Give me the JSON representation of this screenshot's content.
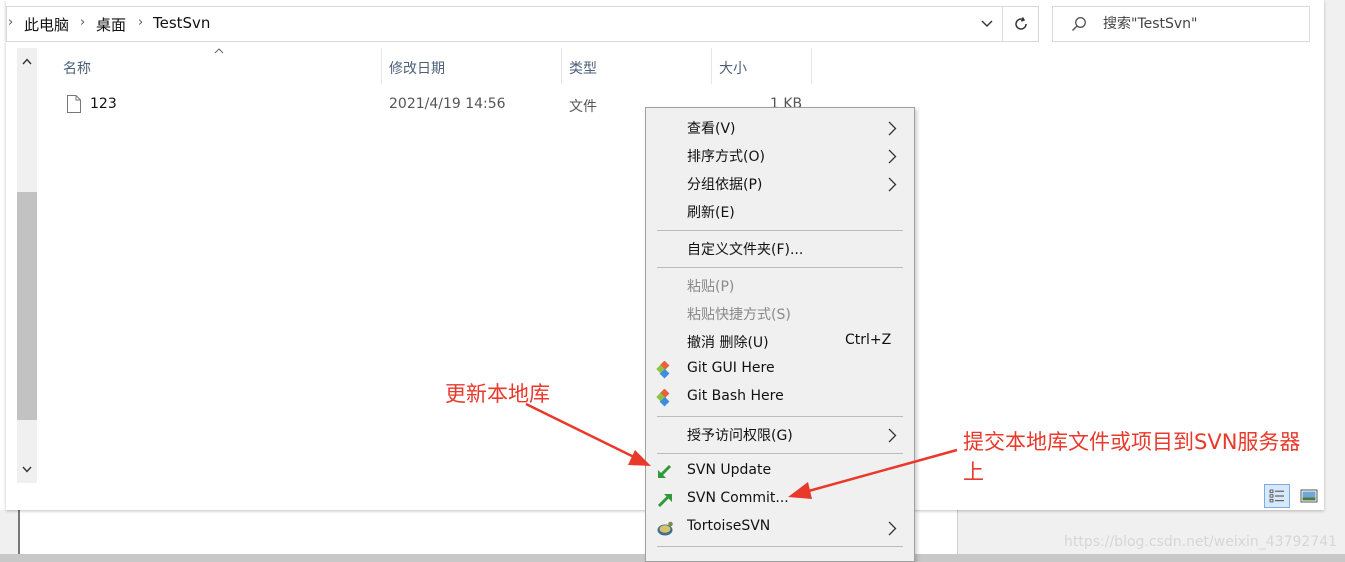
{
  "address_bar": {
    "crumbs": [
      "此电脑",
      "桌面",
      "TestSvn"
    ]
  },
  "search": {
    "placeholder": "搜索\"TestSvn\""
  },
  "columns": {
    "name": "名称",
    "modified": "修改日期",
    "type": "类型",
    "size": "大小"
  },
  "files": [
    {
      "name": "123",
      "modified": "2021/4/19 14:56",
      "type": "文件",
      "size": "1 KB"
    }
  ],
  "context_menu": {
    "items": [
      {
        "label": "查看(V)",
        "submenu": true
      },
      {
        "label": "排序方式(O)",
        "submenu": true
      },
      {
        "label": "分组依据(P)",
        "submenu": true
      },
      {
        "label": "刷新(E)"
      },
      {
        "label": "自定义文件夹(F)..."
      },
      {
        "label": "粘贴(P)",
        "disabled": true
      },
      {
        "label": "粘贴快捷方式(S)",
        "disabled": true
      },
      {
        "label": "撤消 删除(U)",
        "shortcut": "Ctrl+Z"
      },
      {
        "label": "Git GUI Here",
        "icon": "git-gui-icon"
      },
      {
        "label": "Git Bash Here",
        "icon": "git-bash-icon"
      },
      {
        "label": "授予访问权限(G)",
        "submenu": true
      },
      {
        "label": "SVN Update",
        "icon": "svn-update-icon"
      },
      {
        "label": "SVN Commit...",
        "icon": "svn-commit-icon"
      },
      {
        "label": "TortoiseSVN",
        "icon": "tortoisesvn-icon",
        "submenu": true
      }
    ]
  },
  "annotations": {
    "update_note": "更新本地库",
    "commit_note_line1": "提交本地库文件或项目到SVN服务器",
    "commit_note_line2": "上",
    "color": "#e8392b"
  },
  "watermark": "https://blog.csdn.net/weixin_43792741"
}
